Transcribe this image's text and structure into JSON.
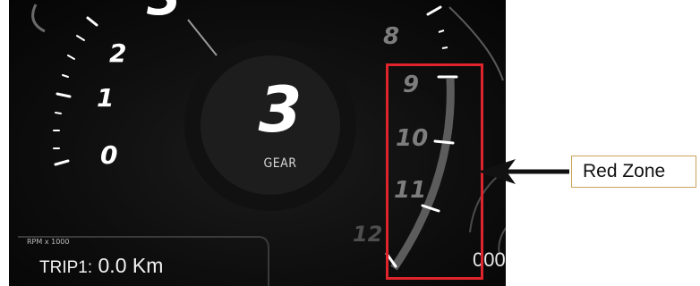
{
  "dashboard": {
    "gear": {
      "value": "3",
      "label": "GEAR"
    },
    "previous_gear": "3",
    "rpm_left_numbers": [
      "2",
      "1",
      "0"
    ],
    "rpm_right_numbers": [
      "8",
      "9",
      "10",
      "11",
      "12"
    ],
    "rpm_unit": "RPM x 1000",
    "trip": {
      "label": "TRIP1:",
      "value": "0.0 Km"
    },
    "odometer_partial": "000"
  },
  "annotation": {
    "label": "Red Zone",
    "box_color": "#e0242b",
    "label_border_color": "#c9a25a",
    "arrow_color": "#111111"
  }
}
